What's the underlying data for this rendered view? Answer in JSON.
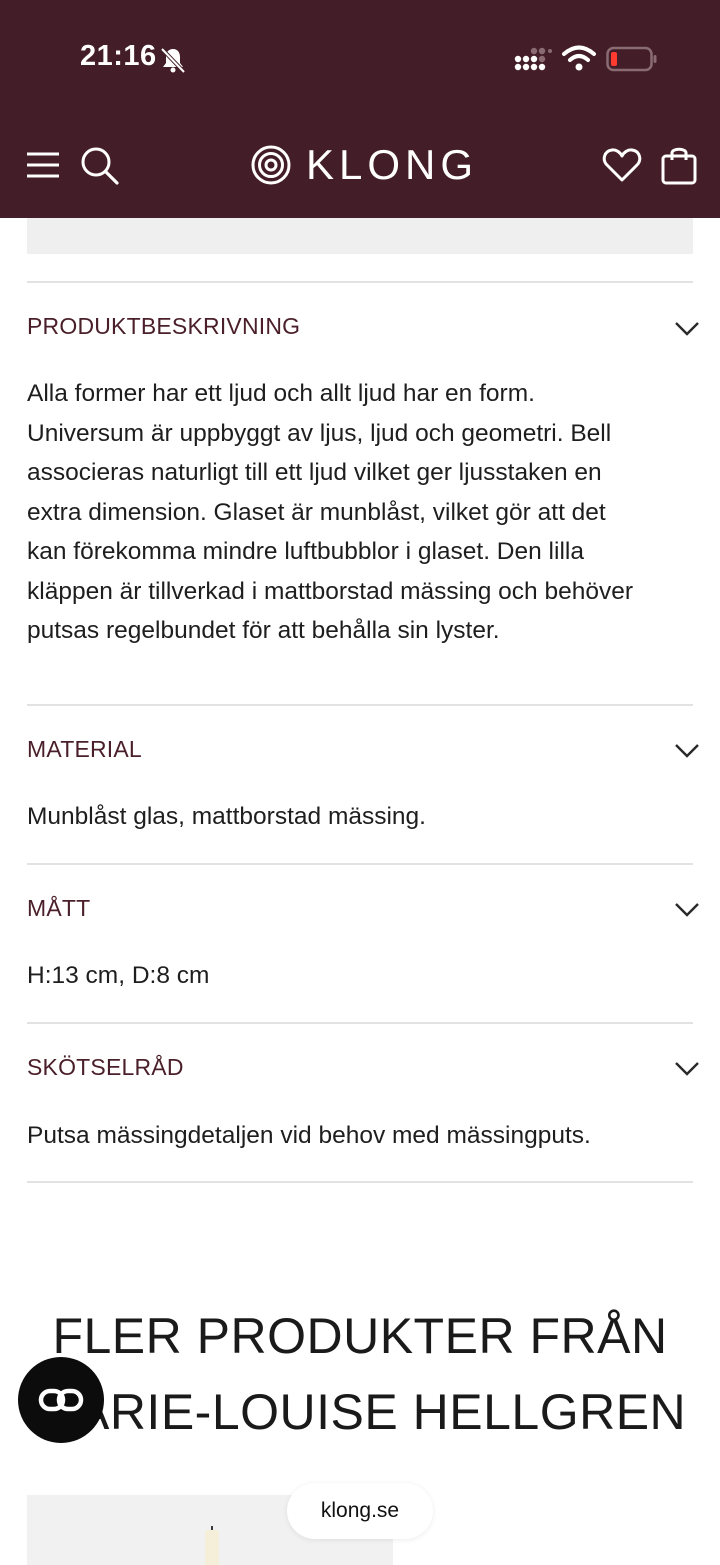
{
  "status_bar": {
    "time": "21:16"
  },
  "header": {
    "brand": "KLONG"
  },
  "sections": [
    {
      "title": "PRODUKTBESKRIVNING",
      "body_lines": [
        "Alla former har ett ljud och allt ljud har en form.",
        "Universum är uppbyggt av ljus, ljud och geometri. Bell",
        "associeras naturligt till ett ljud vilket ger ljusstaken en",
        "extra dimension. Glaset är munblåst, vilket gör att det",
        "kan förekomma mindre luftbubblor i glaset. Den lilla",
        "kläppen är tillverkad i mattborstad mässing och behöver",
        "putsas regelbundet för att behålla sin lyster."
      ]
    },
    {
      "title": "MATERIAL",
      "body": "Munblåst glas, mattborstad mässing."
    },
    {
      "title": "MÅTT",
      "body": "H:13 cm, D:8 cm"
    },
    {
      "title": "SKÖTSELRÅD",
      "body": "Putsa mässingdetaljen vid behov med mässingputs."
    }
  ],
  "more_products": {
    "line1": "FLER PRODUKTER FRÅN",
    "line2": "MARIE-LOUISE HELLGREN"
  },
  "browser": {
    "url": "klong.se"
  },
  "colors": {
    "header_bg": "#431e28",
    "accent_text": "#4a1f29"
  },
  "icons": [
    "bell-slash-icon",
    "signal-icon",
    "wifi-icon",
    "battery-icon",
    "menu-icon",
    "search-icon",
    "klong-logo-icon",
    "heart-icon",
    "bag-icon",
    "chevron-down-icon",
    "chat-icon"
  ]
}
